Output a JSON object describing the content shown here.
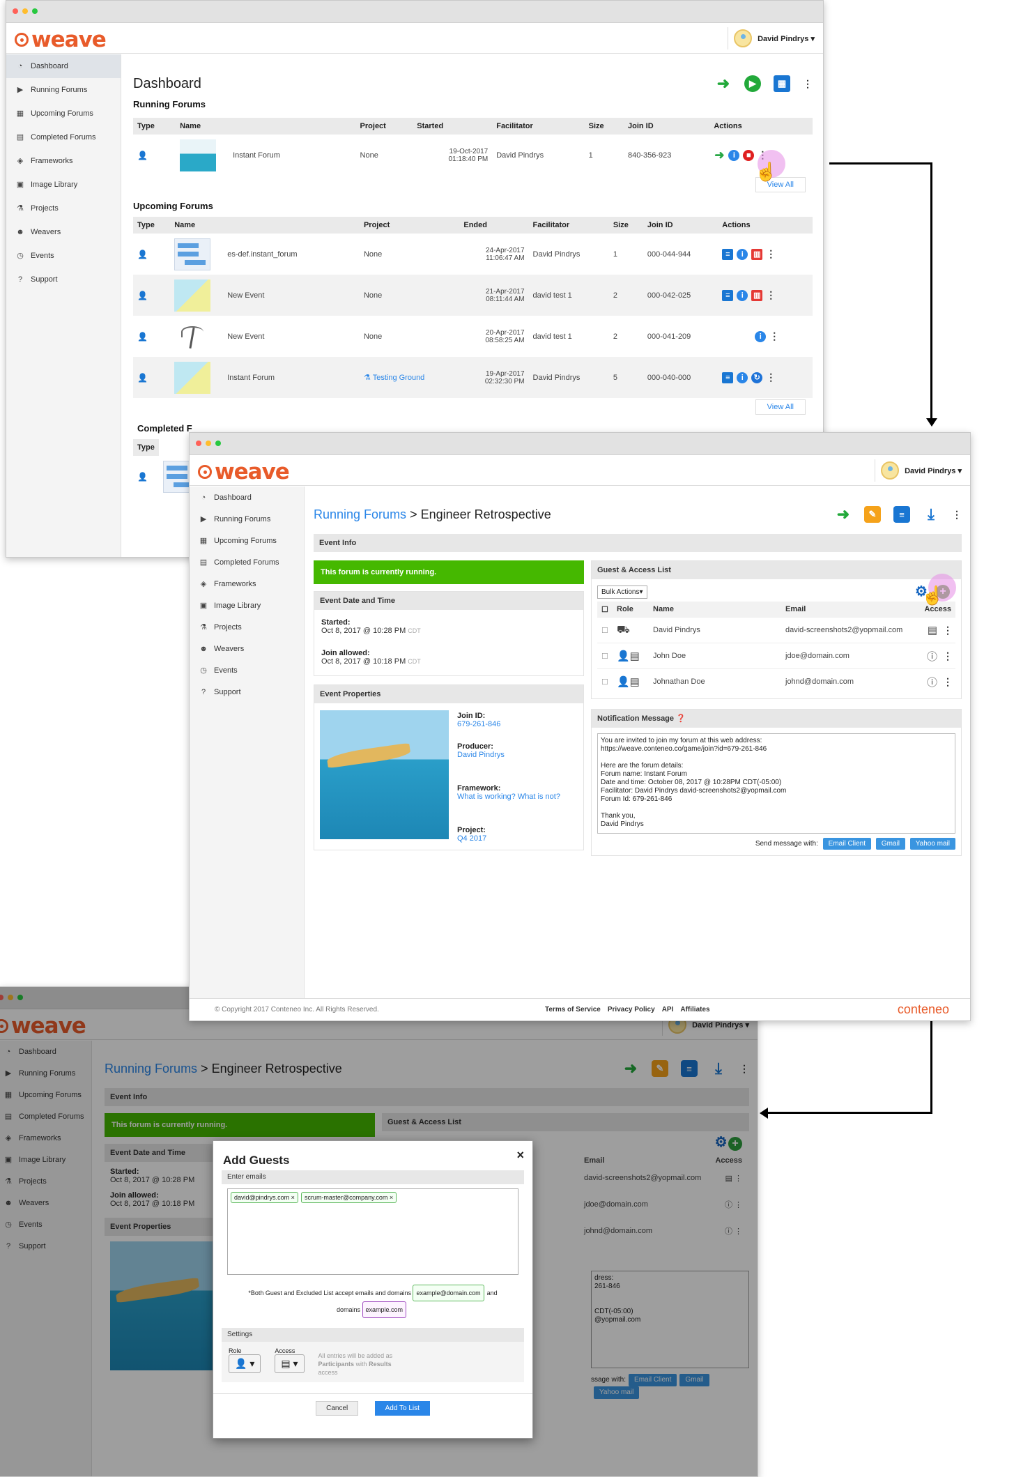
{
  "brand": {
    "name": "weave",
    "footer_brand": "conteneo",
    "accent": "#e85b2a"
  },
  "user": {
    "name": "David Pindrys ▾"
  },
  "sidebar": {
    "items": [
      {
        "label": "Dashboard",
        "icon": "dashboard-icon"
      },
      {
        "label": "Running Forums",
        "icon": "play-circle-icon"
      },
      {
        "label": "Upcoming Forums",
        "icon": "calendar-icon"
      },
      {
        "label": "Completed Forums",
        "icon": "document-icon"
      },
      {
        "label": "Frameworks",
        "icon": "cubes-icon"
      },
      {
        "label": "Image Library",
        "icon": "image-icon"
      },
      {
        "label": "Projects",
        "icon": "flask-icon"
      },
      {
        "label": "Weavers",
        "icon": "users-icon"
      },
      {
        "label": "Events",
        "icon": "clock-icon"
      },
      {
        "label": "Support",
        "icon": "help-icon"
      }
    ]
  },
  "dashboard": {
    "title": "Dashboard",
    "running_title": "Running Forums",
    "upcoming_title": "Upcoming Forums",
    "completed_title": "Completed F",
    "running_headers": [
      "Type",
      "Name",
      "Project",
      "Started",
      "Facilitator",
      "Size",
      "Join ID",
      "Actions"
    ],
    "upcoming_headers": [
      "Type",
      "Name",
      "Project",
      "Ended",
      "Facilitator",
      "Size",
      "Join ID",
      "Actions"
    ],
    "completed_headers": [
      "Type"
    ],
    "running_rows": [
      {
        "name": "Instant Forum",
        "project": "None",
        "date": "19-Oct-2017",
        "time": "01:18:40 PM",
        "facilitator": "David Pindrys",
        "size": "1",
        "join_id": "840-356-923"
      }
    ],
    "upcoming_rows": [
      {
        "name": "es-def.instant_forum",
        "project": "None",
        "date": "24-Apr-2017",
        "time": "11:06:47 AM",
        "facilitator": "David Pindrys",
        "size": "1",
        "join_id": "000-044-944"
      },
      {
        "name": "New Event",
        "project": "None",
        "date": "21-Apr-2017",
        "time": "08:11:44 AM",
        "facilitator": "david test 1",
        "size": "2",
        "join_id": "000-042-025"
      },
      {
        "name": "New Event",
        "project": "None",
        "date": "20-Apr-2017",
        "time": "08:58:25 AM",
        "facilitator": "david test 1",
        "size": "2",
        "join_id": "000-041-209"
      },
      {
        "name": "Instant Forum",
        "project": "Testing Ground",
        "date": "19-Apr-2017",
        "time": "02:32:30 PM",
        "facilitator": "David Pindrys",
        "size": "5",
        "join_id": "000-040-000"
      }
    ],
    "view_all": "View All"
  },
  "forum": {
    "crumb_link": "Running Forums",
    "crumb_sep": ">",
    "crumb_title": "Engineer Retrospective",
    "event_info": "Event Info",
    "running_banner": "This forum is currently running.",
    "date_time_title": "Event Date and Time",
    "started_label": "Started:",
    "started_value": "Oct 8, 2017 @ 10:28 PM",
    "join_allowed_label": "Join allowed:",
    "join_allowed_value": "Oct 8, 2017 @ 10:18 PM",
    "tz": "CDT",
    "props_title": "Event Properties",
    "join_id_label": "Join ID:",
    "join_id_value": "679-261-846",
    "producer_label": "Producer:",
    "producer_value": "David Pindrys",
    "framework_label": "Framework:",
    "framework_value": "What is working? What is not?",
    "project_label": "Project:",
    "project_value": "Q4 2017",
    "guest_title": "Guest & Access List",
    "bulk_actions": "Bulk Actions▾",
    "guest_headers": [
      "Role",
      "Name",
      "Email",
      "Access"
    ],
    "guests": [
      {
        "name": "David Pindrys",
        "email": "david-screenshots2@yopmail.com"
      },
      {
        "name": "John Doe",
        "email": "jdoe@domain.com"
      },
      {
        "name": "Johnathan Doe",
        "email": "johnd@domain.com"
      }
    ],
    "notif_title": "Notification Message",
    "notif_body": "You are invited to join my forum at this web address:\nhttps://weave.conteneo.co/game/join?id=679-261-846\n\nHere are the forum details:\nForum name: Instant Forum\nDate and time: October 08, 2017 @ 10:28PM CDT(-05:00)\nFacilitator:  David Pindrys david-screenshots2@yopmail.com\nForum Id: 679-261-846\n\nThank you,\nDavid Pindrys",
    "send_with": "Send message with:",
    "email_client": "Email Client",
    "gmail": "Gmail",
    "yahoo": "Yahoo mail"
  },
  "footer": {
    "copyright": "© Copyright 2017 Conteneo Inc. All Rights Reserved.",
    "links": [
      "Terms of Service",
      "Privacy Policy",
      "API",
      "Affiliates"
    ]
  },
  "modal": {
    "title": "Add Guests",
    "close": "×",
    "enter_emails": "Enter emails",
    "chips": [
      "david@pindrys.com ×",
      "scrum-master@company.com ×"
    ],
    "note_a": "*Both Guest and Excluded List accept emails and domains",
    "note_chip1": "example@domain.com",
    "note_and": "and",
    "note_b": "domains",
    "note_chip2": "example.com",
    "settings": "Settings",
    "role_label": "Role",
    "access_label": "Access",
    "info_a": "All entries will be added as",
    "info_b": "Participants",
    "info_c": "with",
    "info_d": "Results",
    "info_e": "access",
    "cancel": "Cancel",
    "add": "Add To List"
  },
  "bg_partial": {
    "addr1": "dress:",
    "addr2": "261-846",
    "cdt": "CDT(-05:00)",
    "mail": "@yopmail.com",
    "sage": "ssage with:"
  }
}
